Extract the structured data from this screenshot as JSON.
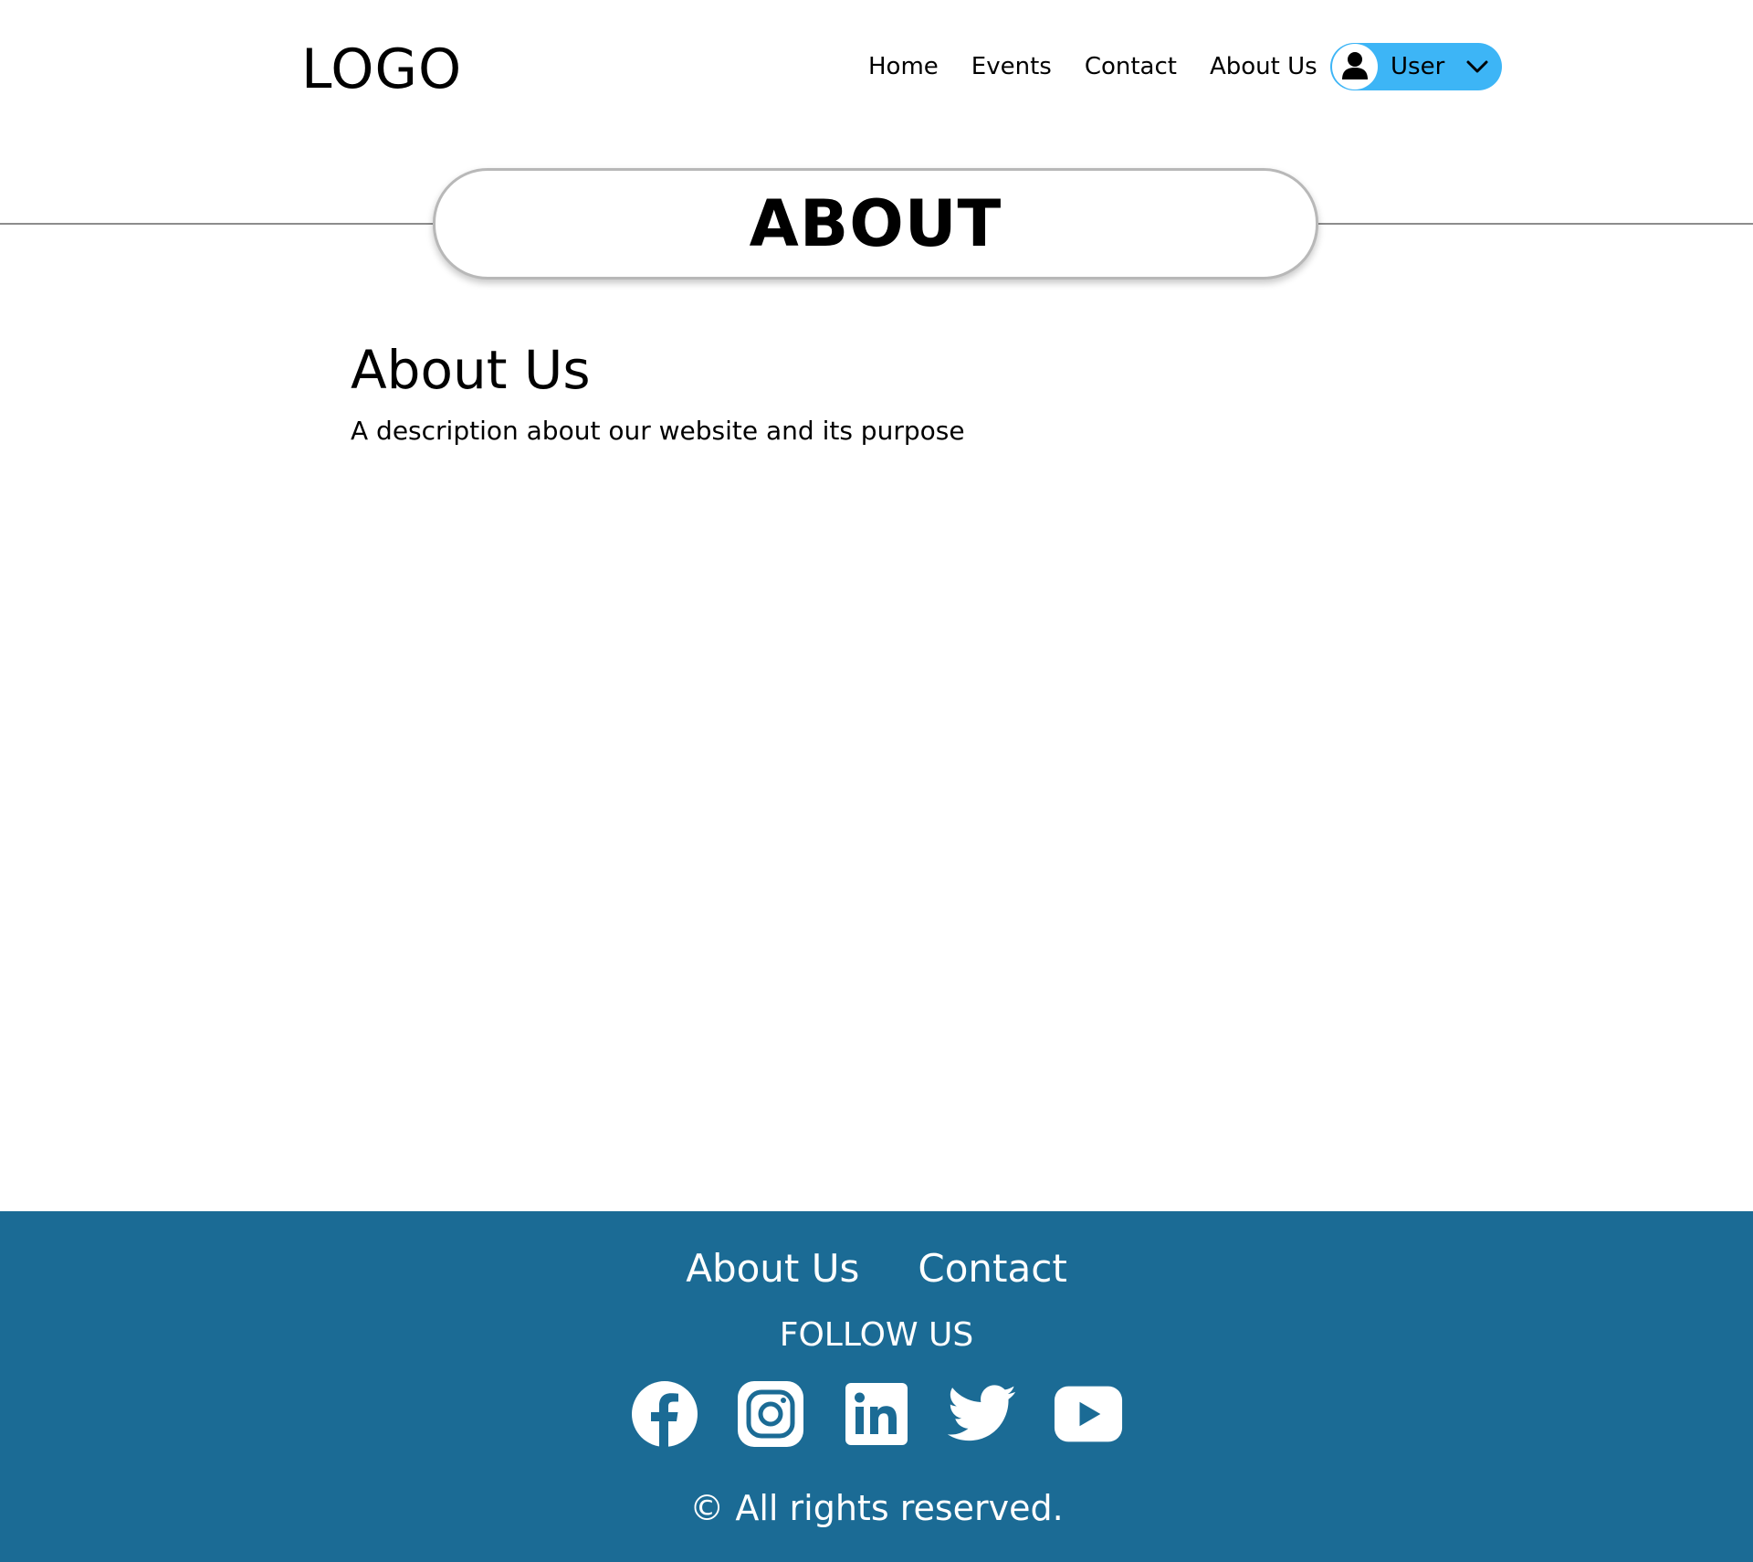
{
  "header": {
    "logo": "LOGO",
    "nav": [
      {
        "label": "Home"
      },
      {
        "label": "Events"
      },
      {
        "label": "Contact"
      },
      {
        "label": "About Us"
      }
    ],
    "user": {
      "label": "User",
      "icon": "user-avatar-icon",
      "dropdown_icon": "chevron-down-icon"
    }
  },
  "page_title": "ABOUT",
  "content": {
    "heading": "About Us",
    "description": "A description about our website and its purpose"
  },
  "footer": {
    "links": [
      {
        "label": "About Us"
      },
      {
        "label": "Contact"
      }
    ],
    "follow_label": "FOLLOW US",
    "socials": [
      "facebook-icon",
      "instagram-icon",
      "linkedin-icon",
      "twitter-icon",
      "youtube-icon"
    ],
    "copyright": "© All rights reserved."
  },
  "colors": {
    "footer_bg": "#1b6b95",
    "user_pill": "#3db5f6",
    "text": "#000000"
  }
}
